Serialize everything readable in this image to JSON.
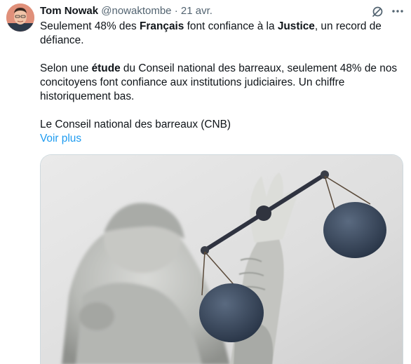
{
  "tweet": {
    "author_name": "Tom Nowak",
    "handle": "@nowaktombe",
    "separator": "·",
    "date": "21 avr.",
    "paragraph1": {
      "t1": "Seulement 48% des ",
      "b1": "Français",
      "t2": " font confiance à la ",
      "b2": "Justice",
      "t3": ", un record de défiance."
    },
    "paragraph2": {
      "t1": "Selon une ",
      "b1": "étude",
      "t2": " du Conseil national des barreaux, seulement 48% de nos concitoyens font confiance aux institutions judiciaires. Un chiffre historiquement bas."
    },
    "paragraph3": "Le Conseil national des barreaux (CNB)",
    "show_more": "Voir plus",
    "icons": {
      "grok": "grok-icon",
      "more": "more-options-icon"
    },
    "colors": {
      "link": "#1d9bf0",
      "muted": "#536471",
      "text": "#0f1419"
    }
  }
}
